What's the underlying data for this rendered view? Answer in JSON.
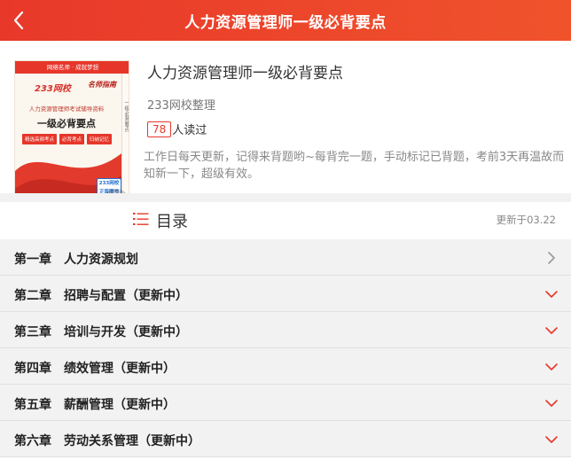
{
  "header": {
    "title": "人力资源管理师一级必背要点"
  },
  "book": {
    "title": "人力资源管理师一级必背要点",
    "author": "233网校整理",
    "read_count": "78",
    "read_label": "人读过",
    "description": "工作日每天更新，记得来背题哟~每背完一题，手动标记已背题，考前3天再温故而知新一下，超级有效。",
    "cover": {
      "banner": "网络名师 · 成就梦想",
      "logo": "233网校",
      "brand": "名师指南",
      "subtitle": "人力资源管理师考试辅导资料",
      "main": "一级必背要点",
      "tags": [
        "精选高频考点",
        "必背考点",
        "归纳记忆"
      ],
      "spine": "一级必背要点",
      "stamp": "233网校 正版图书"
    }
  },
  "toc": {
    "title": "目录",
    "updated": "更新于03.22",
    "chapters": [
      {
        "label": "第一章　人力资源规划",
        "arrow": "right"
      },
      {
        "label": "第二章　招聘与配置（更新中）",
        "arrow": "down"
      },
      {
        "label": "第三章　培训与开发（更新中）",
        "arrow": "down"
      },
      {
        "label": "第四章　绩效管理（更新中）",
        "arrow": "down"
      },
      {
        "label": "第五章　薪酬管理（更新中）",
        "arrow": "down"
      },
      {
        "label": "第六章　劳动关系管理（更新中）",
        "arrow": "down"
      }
    ]
  },
  "icons": {
    "back": "chevron-left-icon",
    "zoom": "zoom-in-icon",
    "toc": "list-icon",
    "collapsed": "chevron-right-icon",
    "expand": "chevron-down-icon"
  },
  "colors": {
    "accent": "#e8382a",
    "header_end": "#f0532c",
    "arrow_gray": "#999999"
  }
}
